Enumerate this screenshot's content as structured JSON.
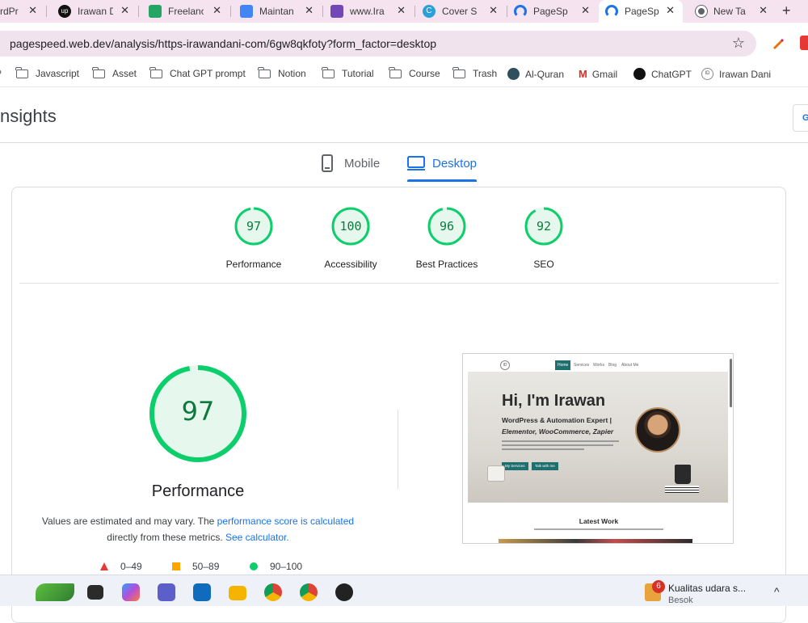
{
  "browser": {
    "tabs": [
      {
        "title": "rdPr",
        "favicon": "wordpress-icon",
        "active": false
      },
      {
        "title": "Irawan D",
        "favicon": "upwork-icon",
        "active": false
      },
      {
        "title": "Freelanc",
        "favicon": "sheets-icon",
        "active": false
      },
      {
        "title": "Maintan",
        "favicon": "docs-icon",
        "active": false
      },
      {
        "title": "www.Ira",
        "favicon": "forms-icon",
        "active": false
      },
      {
        "title": "Cover S",
        "favicon": "canva-icon",
        "active": false
      },
      {
        "title": "PageSp",
        "favicon": "pagespeed-icon",
        "active": false
      },
      {
        "title": "PageSp",
        "favicon": "pagespeed-icon",
        "active": true
      },
      {
        "title": "New Ta",
        "favicon": "chrome-icon",
        "active": false
      }
    ],
    "tab_close_symbol": "✕",
    "new_tab_symbol": "+",
    "url": "pagespeed.web.dev/analysis/https-irawandani-com/6gw8qkfoty?form_factor=desktop",
    "bookmark_star": "☆",
    "bookmarks": [
      {
        "label": "Javascript",
        "icon": "folder-icon"
      },
      {
        "label": "Asset",
        "icon": "folder-icon"
      },
      {
        "label": "Chat GPT prompt",
        "icon": "folder-icon"
      },
      {
        "label": "Notion",
        "icon": "folder-icon"
      },
      {
        "label": "Tutorial",
        "icon": "folder-icon"
      },
      {
        "label": "Course",
        "icon": "folder-icon"
      },
      {
        "label": "Trash",
        "icon": "folder-icon"
      },
      {
        "label": "Al-Quran",
        "icon": "quran-icon"
      },
      {
        "label": "Gmail",
        "icon": "gmail-icon"
      },
      {
        "label": "ChatGPT",
        "icon": "chatgpt-icon"
      },
      {
        "label": "Irawan Dani",
        "icon": "id-logo-icon"
      }
    ]
  },
  "header": {
    "brand": "nsights",
    "button_label": "G"
  },
  "device_tabs": {
    "mobile": "Mobile",
    "desktop": "Desktop",
    "selected": "desktop"
  },
  "scores": [
    {
      "label": "Performance",
      "value": "97",
      "fraction": 0.97
    },
    {
      "label": "Accessibility",
      "value": "100",
      "fraction": 1.0
    },
    {
      "label": "Best Practices",
      "value": "96",
      "fraction": 0.96
    },
    {
      "label": "SEO",
      "value": "92",
      "fraction": 0.92
    }
  ],
  "performance": {
    "score": "97",
    "fraction": 0.97,
    "title": "Performance",
    "note_prefix": "Values are estimated and may vary. The ",
    "note_link": "performance score is calculated",
    "note_middle": "directly from these metrics. ",
    "note_link2": "See calculator."
  },
  "legend": [
    {
      "range": "0–49",
      "shape": "triangle",
      "color": "#e53935"
    },
    {
      "range": "50–89",
      "shape": "square",
      "color": "#ffa400"
    },
    {
      "range": "90–100",
      "shape": "circle",
      "color": "#0cce6b"
    }
  ],
  "screenshot": {
    "logo": "ID",
    "menu": [
      "Home",
      "Services",
      "Works",
      "Blog",
      "About Me"
    ],
    "headline": "Hi, I'm Irawan",
    "subtitle1": "WordPress & Automation Expert |",
    "subtitle2": "Elementor, WooCommerce, Zapier",
    "buttons": [
      "My Services",
      "Talk with me"
    ],
    "section_title": "Latest Work"
  },
  "taskbar": {
    "notification_count": "6",
    "weather_title": "Kualitas udara s...",
    "weather_sub": "Besok",
    "tray_chevron": "^"
  },
  "colors": {
    "pass_green": "#0cce6b",
    "pass_text": "#0c7a3e",
    "pass_fill": "#e6f8ee",
    "accent_blue": "#1a73e8"
  }
}
